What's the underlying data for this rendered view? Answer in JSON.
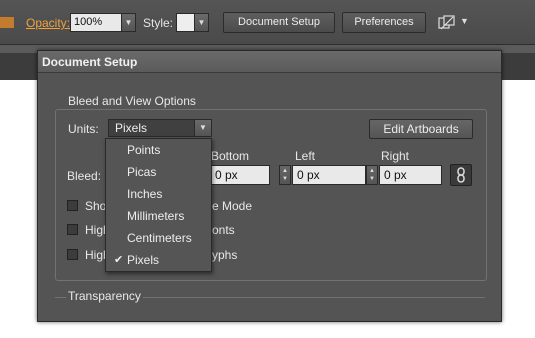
{
  "topbar": {
    "opacity_label": "Opacity:",
    "opacity_value": "100%",
    "style_label": "Style:",
    "document_setup_button": "Document Setup",
    "preferences_button": "Preferences",
    "arrange_icon": "arrange-documents-icon"
  },
  "dialog": {
    "title": "Document Setup",
    "bleed_group_title": "Bleed and View Options",
    "units_label": "Units:",
    "units_value": "Pixels",
    "edit_artboards_button": "Edit Artboards",
    "bleed_label": "Bleed:",
    "bleed": {
      "bottom_label": "Bottom",
      "bottom_value": "0 px",
      "left_label": "Left",
      "left_value": "0 px",
      "right_label": "Right",
      "right_value": "0 px",
      "link_icon": "chain-link-icon"
    },
    "checkboxes": [
      {
        "prefix": "Sho",
        "suffix": "e Mode"
      },
      {
        "prefix": "High",
        "suffix": "onts"
      },
      {
        "prefix": "High",
        "suffix": "yphs"
      }
    ],
    "transparency_title": "Transparency"
  },
  "units_dropdown": {
    "options": [
      "Points",
      "Picas",
      "Inches",
      "Millimeters",
      "Centimeters",
      "Pixels"
    ],
    "selected": "Pixels",
    "check_glyph": "✔"
  },
  "colors": {
    "panel": "#545454",
    "accent_label": "#f0a33c",
    "field_bg": "#e9e9e9"
  }
}
